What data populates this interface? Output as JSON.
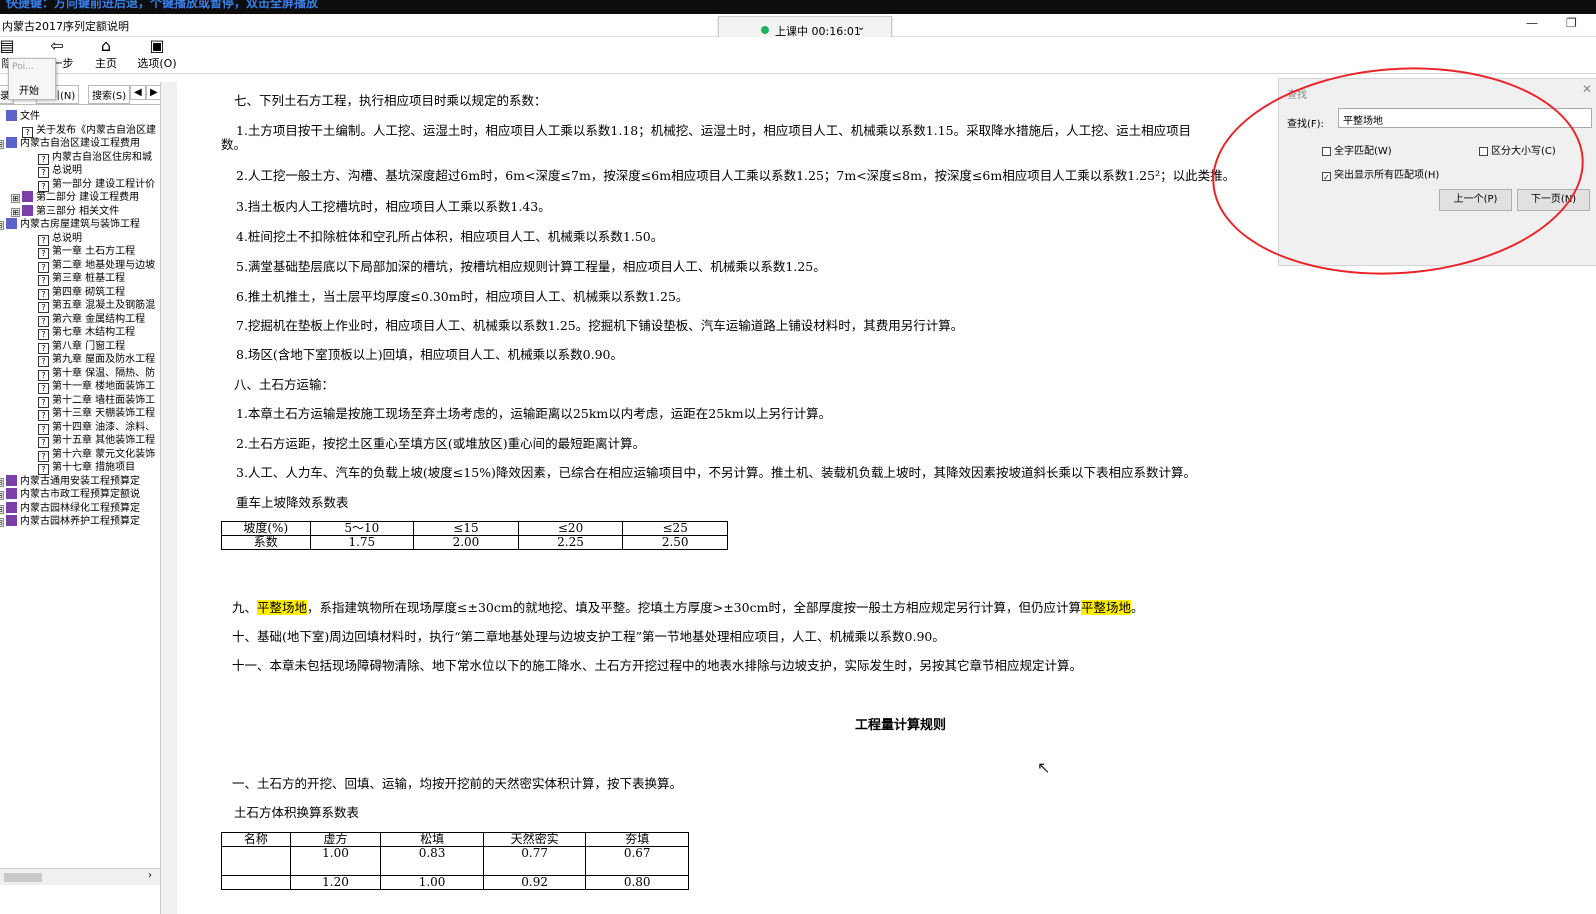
{
  "top_banner": "快捷键：方向键前进后退，个键播放或暂停，双击全屏播放",
  "window": {
    "title": "内蒙古2017序列定额说明",
    "minimize": "—",
    "restore": "❐"
  },
  "live": {
    "status": "上课中 00:16:01",
    "chevron": "⌄"
  },
  "toolbar": [
    {
      "icon": "▤",
      "label": "隐"
    },
    {
      "icon": "⇦",
      "label": "后一步"
    },
    {
      "icon": "⌂",
      "label": "主页"
    },
    {
      "icon": "▣",
      "label": "选项(O)"
    }
  ],
  "popup": {
    "title": "Poi...",
    "item": "开始"
  },
  "side_tabs": [
    "目录",
    "索引(N)",
    "搜索(S)",
    "◀",
    "▶"
  ],
  "tree": [
    {
      "level": 0,
      "exp": "",
      "icon": "book",
      "text": "文件"
    },
    {
      "level": 1,
      "exp": "",
      "icon": "q",
      "text": "关于发布《内蒙古自治区建"
    },
    {
      "level": 0,
      "exp": "⊟",
      "icon": "book",
      "text": "内蒙古自治区建设工程费用"
    },
    {
      "level": 2,
      "exp": "",
      "icon": "q",
      "text": "内蒙古自治区住房和城"
    },
    {
      "level": 2,
      "exp": "",
      "icon": "q",
      "text": "总说明"
    },
    {
      "level": 2,
      "exp": "",
      "icon": "q",
      "text": "第一部分  建设工程计价"
    },
    {
      "level": 1,
      "exp": "⊞",
      "icon": "p",
      "text": "第二部分  建设工程费用"
    },
    {
      "level": 1,
      "exp": "⊞",
      "icon": "p",
      "text": "第三部分  相关文件"
    },
    {
      "level": 0,
      "exp": "⊟",
      "icon": "book",
      "text": "内蒙古房屋建筑与装饰工程"
    },
    {
      "level": 2,
      "exp": "",
      "icon": "q",
      "text": "总说明"
    },
    {
      "level": 2,
      "exp": "",
      "icon": "q",
      "text": "第一章  土石方工程"
    },
    {
      "level": 2,
      "exp": "",
      "icon": "q",
      "text": "第二章  地基处理与边坡"
    },
    {
      "level": 2,
      "exp": "",
      "icon": "q",
      "text": "第三章  桩基工程"
    },
    {
      "level": 2,
      "exp": "",
      "icon": "q",
      "text": "第四章  砌筑工程"
    },
    {
      "level": 2,
      "exp": "",
      "icon": "q",
      "text": "第五章  混凝土及钢筋混"
    },
    {
      "level": 2,
      "exp": "",
      "icon": "q",
      "text": "第六章  金属结构工程"
    },
    {
      "level": 2,
      "exp": "",
      "icon": "q",
      "text": "第七章  木结构工程"
    },
    {
      "level": 2,
      "exp": "",
      "icon": "q",
      "text": "第八章  门窗工程"
    },
    {
      "level": 2,
      "exp": "",
      "icon": "q",
      "text": "第九章  屋面及防水工程"
    },
    {
      "level": 2,
      "exp": "",
      "icon": "q",
      "text": "第十章  保温、隔热、防"
    },
    {
      "level": 2,
      "exp": "",
      "icon": "q",
      "text": "第十一章  楼地面装饰工"
    },
    {
      "level": 2,
      "exp": "",
      "icon": "q",
      "text": "第十二章  墙柱面装饰工"
    },
    {
      "level": 2,
      "exp": "",
      "icon": "q",
      "text": "第十三章  天棚装饰工程"
    },
    {
      "level": 2,
      "exp": "",
      "icon": "q",
      "text": "第十四章  油漆、涂料、"
    },
    {
      "level": 2,
      "exp": "",
      "icon": "q",
      "text": "第十五章  其他装饰工程"
    },
    {
      "level": 2,
      "exp": "",
      "icon": "q",
      "text": "第十六章  蒙元文化装饰"
    },
    {
      "level": 2,
      "exp": "",
      "icon": "q",
      "text": "第十七章  措施项目"
    },
    {
      "level": 0,
      "exp": "⊞",
      "icon": "p",
      "text": "内蒙古通用安装工程预算定"
    },
    {
      "level": 0,
      "exp": "⊞",
      "icon": "p",
      "text": "内蒙古市政工程预算定额说"
    },
    {
      "level": 0,
      "exp": "⊞",
      "icon": "p",
      "text": "内蒙古园林绿化工程预算定"
    },
    {
      "level": 0,
      "exp": "⊞",
      "icon": "p",
      "text": "内蒙古园林养护工程预算定"
    }
  ],
  "content": {
    "p7": "七、下列土石方工程，执行相应项目时乘以规定的系数：",
    "p7_1": "1.土方项目按干土编制。人工挖、运湿土时，相应项目人工乘以系数1.18；机械挖、运湿土时，相应项目人工、机械乘以系数1.15。采取降水措施后，人工挖、运土相应项目",
    "p7_1b": "数。",
    "p7_2": "2.人工挖一般土方、沟槽、基坑深度超过6m时，6m<深度≤7m，按深度≤6m相应项目人工乘以系数1.25；7m<深度≤8m，按深度≤6m相应项目人工乘以系数1.25²；以此类推。",
    "p7_3": "3.挡土板内人工挖槽坑时，相应项目人工乘以系数1.43。",
    "p7_4": "4.桩间挖土不扣除桩体和空孔所占体积，相应项目人工、机械乘以系数1.50。",
    "p7_5": "5.满堂基础垫层底以下局部加深的槽坑，按槽坑相应规则计算工程量，相应项目人工、机械乘以系数1.25。",
    "p7_6": "6.推土机推土，当土层平均厚度≤0.30m时，相应项目人工、机械乘以系数1.25。",
    "p7_7": "7.挖掘机在垫板上作业时，相应项目人工、机械乘以系数1.25。挖掘机下铺设垫板、汽车运输道路上铺设材料时，其费用另行计算。",
    "p7_8": "8.场区(含地下室顶板以上)回填，相应项目人工、机械乘以系数0.90。",
    "p8": "八、土石方运输：",
    "p8_1": "1.本章土石方运输是按施工现场至弃土场考虑的，运输距离以25km以内考虑，运距在25km以上另行计算。",
    "p8_2": "2.土石方运距，按挖土区重心至填方区(或堆放区)重心间的最短距离计算。",
    "p8_3": "3.人工、人力车、汽车的负载上坡(坡度≤15%)降效因素，已综合在相应运输项目中，不另计算。推土机、装载机负载上坡时，其降效因素按坡道斜长乘以下表相应系数计算。",
    "table1_title": "重车上坡降效系数表",
    "table1": {
      "header": [
        "坡度(%)",
        "5～10",
        "≤15",
        "≤20",
        "≤25"
      ],
      "row": [
        "系数",
        "1.75",
        "2.00",
        "2.25",
        "2.50"
      ]
    },
    "p9_a": "九、",
    "p9_hl": "平整场地",
    "p9_b": "，系指建筑物所在现场厚度≤±30cm的就地挖、填及平整。挖填土方厚度>±30cm时，全部厚度按一般土方相应规定另行计算，但仍应计算",
    "p9_hl2": "平整场地",
    "p9_c": "。",
    "p10": "十、基础(地下室)周边回填材料时，执行“第二章地基处理与边坡支护工程”第一节地基处理相应项目，人工、机械乘以系数0.90。",
    "p11": "十一、本章未包括现场障碍物清除、地下常水位以下的施工降水、土石方开挖过程中的地表水排除与边坡支护，实际发生时，另按其它章节相应规定计算。",
    "heading": "工程量计算规则",
    "r1": "一、土石方的开挖、回填、运输，均按开挖前的天然密实体积计算，按下表换算。",
    "table2_title": "土石方体积换算系数表",
    "table2": {
      "header": [
        "名称",
        "虚方",
        "松填",
        "天然密实",
        "夯填"
      ],
      "rows": [
        [
          "",
          "1.00",
          "0.83",
          "0.77",
          "0.67"
        ],
        [
          "",
          "1.20",
          "1.00",
          "0.92",
          "0.80"
        ]
      ]
    }
  },
  "find": {
    "title": "查找",
    "close": "✕",
    "label": "查找(F):",
    "value": "平整场地",
    "whole_word": "全字匹配(W)",
    "match_case": "区分大小写(C)",
    "highlight_all": "突出显示所有匹配项(H)",
    "prev": "上一个(P)",
    "next": "下一页(N)",
    "check_mark": "✓"
  },
  "cursor": "↖"
}
